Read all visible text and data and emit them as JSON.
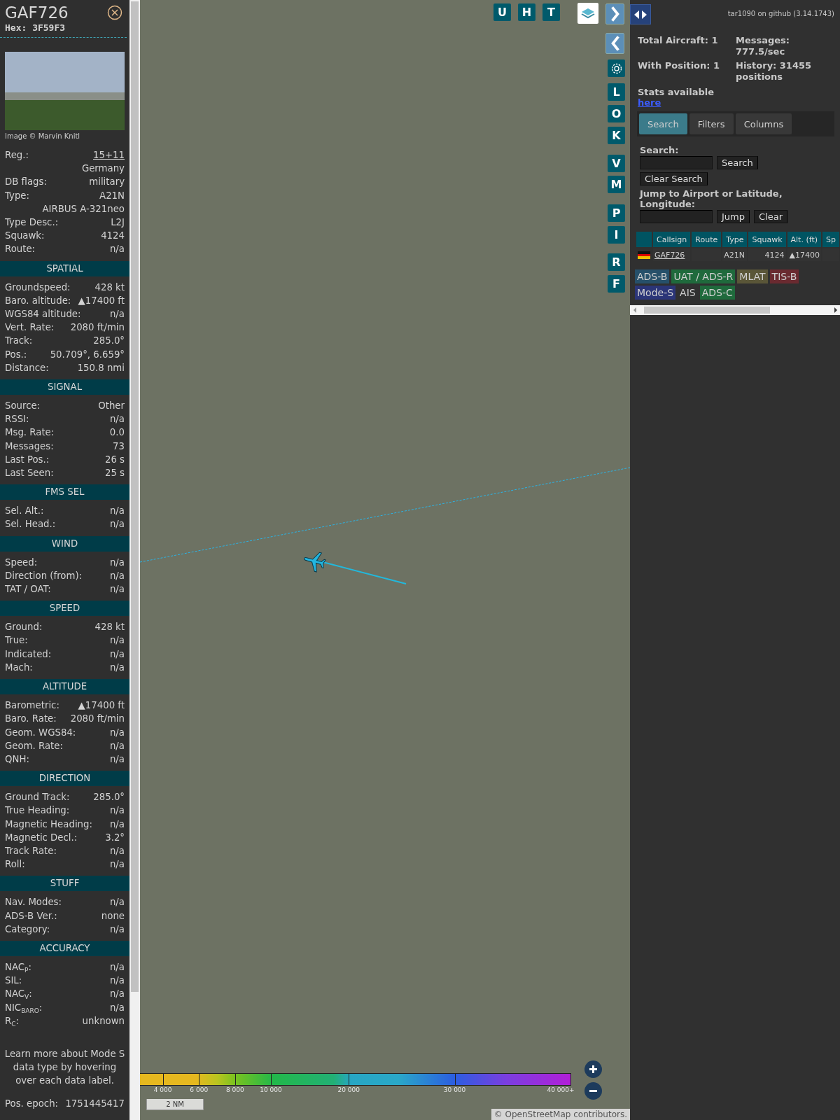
{
  "detail_panel": {
    "callsign": "GAF726",
    "hex": "Hex: 3F59F3",
    "photo_credit": "Image © Marvin Knitl",
    "rows": [
      {
        "kind": "link",
        "label": "Reg.:",
        "value": "15+11"
      },
      {
        "kind": "continuation",
        "value": "Germany"
      },
      {
        "kind": "field",
        "label": "DB flags:",
        "value": "military"
      },
      {
        "kind": "field",
        "label": "Type:",
        "value": "A21N"
      },
      {
        "kind": "continuation",
        "value": "AIRBUS A-321neo"
      },
      {
        "kind": "field",
        "label": "Type Desc.:",
        "value": "L2J"
      },
      {
        "kind": "field",
        "label": "Squawk:",
        "value": "4124"
      },
      {
        "kind": "field",
        "label": "Route:",
        "value": "n/a"
      }
    ],
    "sections": [
      {
        "title": "SPATIAL",
        "rows": [
          {
            "kind": "field",
            "label": "Groundspeed:",
            "value": "428 kt"
          },
          {
            "kind": "field",
            "label": "Baro. altitude:",
            "value": "▲17400 ft"
          },
          {
            "kind": "field",
            "label": "WGS84 altitude:",
            "value": "n/a"
          },
          {
            "kind": "field",
            "label": "Vert. Rate:",
            "value": "2080 ft/min"
          },
          {
            "kind": "field",
            "label": "Track:",
            "value": "285.0°"
          },
          {
            "kind": "field",
            "label": "Pos.:",
            "value": "50.709°, 6.659°"
          },
          {
            "kind": "field",
            "label": "Distance:",
            "value": "150.8 nmi"
          }
        ]
      },
      {
        "title": "SIGNAL",
        "rows": [
          {
            "kind": "field",
            "label": "Source:",
            "value": "Other"
          },
          {
            "kind": "field",
            "label": "RSSI:",
            "value": "n/a"
          },
          {
            "kind": "field",
            "label": "Msg. Rate:",
            "value": "0.0"
          },
          {
            "kind": "field",
            "label": "Messages:",
            "value": "73"
          },
          {
            "kind": "field",
            "label": "Last Pos.:",
            "value": "26 s"
          },
          {
            "kind": "field",
            "label": "Last Seen:",
            "value": "25 s"
          }
        ]
      },
      {
        "title": "FMS SEL",
        "rows": [
          {
            "kind": "field",
            "label": "Sel. Alt.:",
            "value": "n/a"
          },
          {
            "kind": "field",
            "label": "Sel. Head.:",
            "value": "n/a"
          }
        ]
      },
      {
        "title": "WIND",
        "rows": [
          {
            "kind": "field",
            "label": "Speed:",
            "value": "n/a"
          },
          {
            "kind": "field",
            "label": "Direction (from):",
            "value": "n/a"
          },
          {
            "kind": "field",
            "label": "TAT / OAT:",
            "value": "n/a"
          }
        ]
      },
      {
        "title": "SPEED",
        "rows": [
          {
            "kind": "field",
            "label": "Ground:",
            "value": "428 kt"
          },
          {
            "kind": "field",
            "label": "True:",
            "value": "n/a"
          },
          {
            "kind": "field",
            "label": "Indicated:",
            "value": "n/a"
          },
          {
            "kind": "field",
            "label": "Mach:",
            "value": "n/a"
          }
        ]
      },
      {
        "title": "ALTITUDE",
        "rows": [
          {
            "kind": "field",
            "label": "Barometric:",
            "value": "▲17400 ft"
          },
          {
            "kind": "field",
            "label": "Baro. Rate:",
            "value": "2080 ft/min"
          },
          {
            "kind": "field",
            "label": "Geom. WGS84:",
            "value": "n/a"
          },
          {
            "kind": "field",
            "label": "Geom. Rate:",
            "value": "n/a"
          },
          {
            "kind": "field",
            "label": "QNH:",
            "value": "n/a"
          }
        ]
      },
      {
        "title": "DIRECTION",
        "rows": [
          {
            "kind": "field",
            "label": "Ground Track:",
            "value": "285.0°"
          },
          {
            "kind": "field",
            "label": "True Heading:",
            "value": "n/a"
          },
          {
            "kind": "field",
            "label": "Magnetic Heading:",
            "value": "n/a"
          },
          {
            "kind": "field",
            "label": "Magnetic Decl.:",
            "value": "3.2°"
          },
          {
            "kind": "field",
            "label": "Track Rate:",
            "value": "n/a"
          },
          {
            "kind": "field",
            "label": "Roll:",
            "value": "n/a"
          }
        ]
      },
      {
        "title": "STUFF",
        "rows": [
          {
            "kind": "field",
            "label": "Nav. Modes:",
            "value": "n/a"
          },
          {
            "kind": "field",
            "label": "ADS-B Ver.:",
            "value": "none"
          },
          {
            "kind": "field",
            "label": "Category:",
            "value": "n/a"
          }
        ]
      },
      {
        "title": "ACCURACY",
        "rows": [
          {
            "kind": "field",
            "label": "NAC$_{P}$:",
            "value": "n/a"
          },
          {
            "kind": "field",
            "label": "SIL:",
            "value": "n/a"
          },
          {
            "kind": "field",
            "label": "NAC$_{V}$:",
            "value": "n/a"
          },
          {
            "kind": "field",
            "label": "NIC$_{BARO}$:",
            "value": "n/a"
          },
          {
            "kind": "field",
            "label": "R$_{C}$:",
            "value": "unknown"
          }
        ]
      }
    ],
    "note": "Learn more about Mode S data type by hovering over each data label.",
    "footer": {
      "label": "Pos. epoch:",
      "value": "1751445417"
    }
  },
  "map": {
    "top_buttons": [
      "U",
      "H",
      "T"
    ],
    "side_buttons": [
      "L",
      "O",
      "K",
      "V",
      "M",
      "P",
      "I",
      "R",
      "F"
    ],
    "altitude_legend": [
      "4 000",
      "6 000",
      "8 000",
      "10 000",
      "20 000",
      "30 000",
      "40 000+"
    ],
    "scale": "2 NM",
    "attribution": "© OpenStreetMap contributors."
  },
  "side_panel": {
    "github_link": "tar1090 on github (3.14.1743)",
    "stats": [
      {
        "label": "Total Aircraft:",
        "value": "1"
      },
      {
        "label": "Messages:",
        "value": "777.5/sec"
      },
      {
        "label": "With Position:",
        "value": "1"
      },
      {
        "label": "History:",
        "value": "31455 positions"
      }
    ],
    "stats_note": "Stats available",
    "stats_link": "here",
    "tabs": [
      {
        "label": "Search",
        "selected": true
      },
      {
        "label": "Filters",
        "selected": false
      },
      {
        "label": "Columns",
        "selected": false
      }
    ],
    "search_label": "Search:",
    "search_button": "Search",
    "clear_search_button": "Clear Search",
    "jump_label": "Jump to Airport or Latitude, Longitude:",
    "jump_button": "Jump",
    "clear_button": "Clear",
    "table": {
      "columns": [
        "Callsign",
        "Route",
        "Type",
        "Squawk",
        "Alt. (ft)",
        "Sp"
      ],
      "rows": [
        {
          "callsign": "GAF726",
          "type": "A21N",
          "squawk": "4124",
          "altitude": "▲17400"
        }
      ]
    },
    "sources": [
      {
        "label": "ADS-B",
        "color": "#26506a"
      },
      {
        "label": "UAT / ADS-R",
        "color": "#1f6a3c"
      },
      {
        "label": "MLAT",
        "color": "#5a5638"
      },
      {
        "label": "TIS-B",
        "color": "#6a2a30"
      },
      {
        "label": "Mode-S",
        "color": "#2b3578"
      },
      {
        "label": "AIS"
      },
      {
        "label": "ADS-C",
        "color": "#1f6a3c"
      }
    ]
  }
}
